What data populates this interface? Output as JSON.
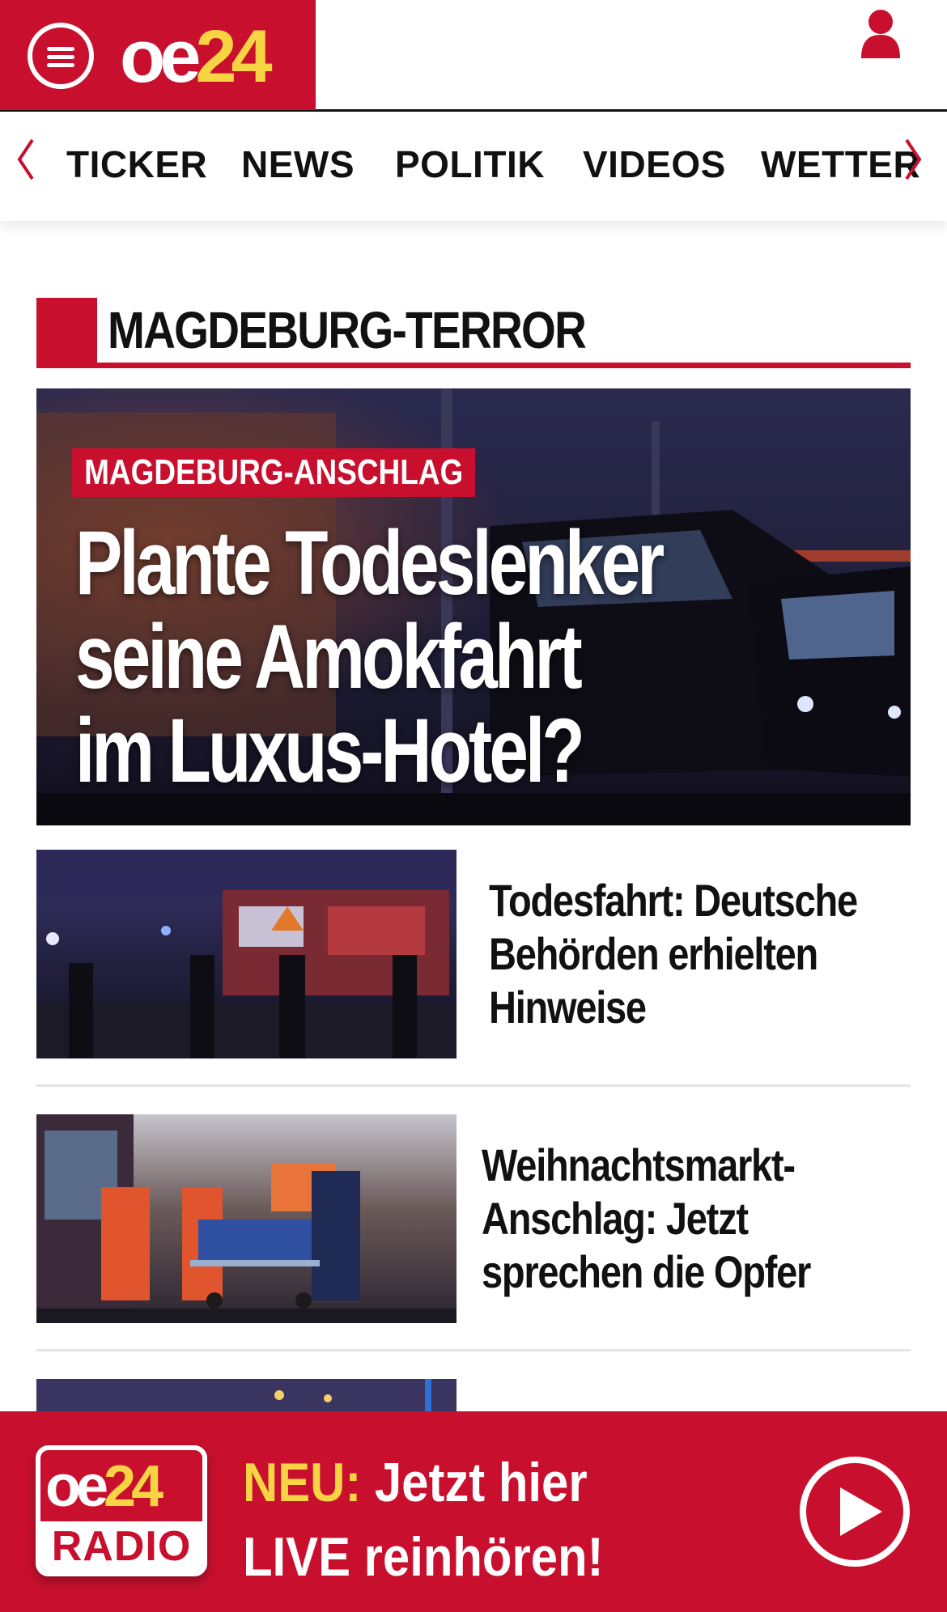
{
  "header": {
    "logo_oe": "oe",
    "logo_24": "24",
    "menu_icon": "hamburger-menu-icon",
    "user_icon": "user-icon"
  },
  "nav": {
    "items": [
      "TICKER",
      "NEWS",
      "POLITIK",
      "VIDEOS",
      "WETTER"
    ],
    "left_arrow_icon": "chevron-left-icon",
    "right_arrow_icon": "chevron-right-icon"
  },
  "section": {
    "title": "MAGDEBURG-TERROR"
  },
  "hero": {
    "kicker": "MAGDEBURG-ANSCHLAG",
    "title_lines": [
      "Plante Todeslenker",
      "seine Amokfahrt",
      "im Luxus-Hotel?"
    ]
  },
  "articles": [
    {
      "title": "Todesfahrt: Deutsche Behörden erhielten Hinweise"
    },
    {
      "title": "Weihnachtsmarkt-Anschlag: Jetzt sprechen die Opfer"
    }
  ],
  "radio": {
    "logo_oe": "oe",
    "logo_24": "24",
    "logo_label": "RADIO",
    "highlight": "NEU:",
    "line1_rest": " Jetzt hier",
    "line2": "LIVE reinhören!",
    "play_icon": "play-icon"
  },
  "colors": {
    "brand_red": "#c8102e",
    "accent_yellow": "#f6d443"
  }
}
